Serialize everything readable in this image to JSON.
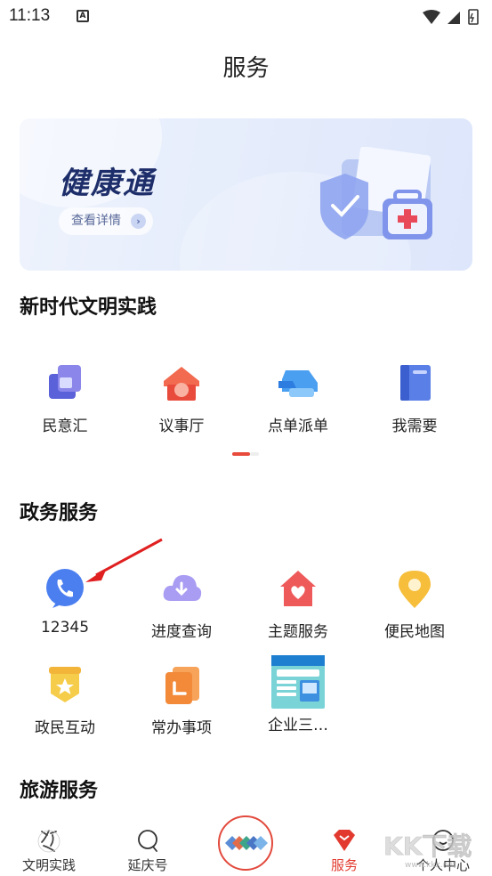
{
  "status_bar": {
    "time": "11:13",
    "notification_glyph": "A"
  },
  "header": {
    "title": "服务"
  },
  "banner": {
    "title": "健康通",
    "button_label": "查看详情",
    "chevron": "›"
  },
  "sections": {
    "civilization": {
      "title": "新时代文明实践",
      "items": [
        {
          "label": "民意汇",
          "icon": "stacked-squares-icon"
        },
        {
          "label": "议事厅",
          "icon": "house-icon"
        },
        {
          "label": "点单派单",
          "icon": "truck-icon"
        },
        {
          "label": "我需要",
          "icon": "book-icon"
        }
      ]
    },
    "government": {
      "title": "政务服务",
      "items": [
        {
          "label": "12345",
          "icon": "phone-icon"
        },
        {
          "label": "进度查询",
          "icon": "cloud-download-icon"
        },
        {
          "label": "主题服务",
          "icon": "heart-house-icon"
        },
        {
          "label": "便民地图",
          "icon": "location-pin-icon"
        },
        {
          "label": "政民互动",
          "icon": "star-badge-icon"
        },
        {
          "label": "常办事项",
          "icon": "document-icon"
        },
        {
          "label": "企业三…",
          "icon": "enterprise-thumbnail-icon"
        }
      ]
    },
    "tourism": {
      "title": "旅游服务"
    }
  },
  "tab_bar": {
    "tabs": [
      {
        "label": "文明实践",
        "icon": "calligraphy-icon"
      },
      {
        "label": "延庆号",
        "icon": "chat-bubble-icon"
      },
      {
        "label": "",
        "icon": "center-logo-icon"
      },
      {
        "label": "服务",
        "icon": "service-gem-icon",
        "active": true
      },
      {
        "label": "个人中心",
        "icon": "person-icon"
      }
    ]
  },
  "watermark": {
    "text": "KK下载",
    "url_text": "www.kkx.net"
  },
  "colors": {
    "accent": "#e23a2e",
    "banner_title": "#1e2e6a"
  }
}
